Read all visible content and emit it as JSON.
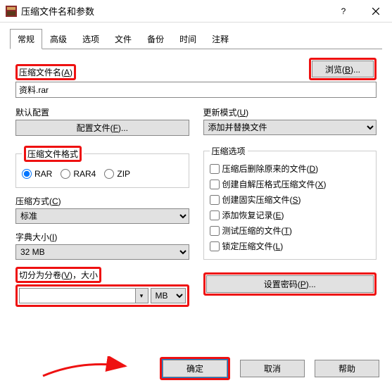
{
  "window": {
    "title": "压缩文件名和参数"
  },
  "tabs": [
    "常规",
    "高级",
    "选项",
    "文件",
    "备份",
    "时间",
    "注释"
  ],
  "archive_name": {
    "label_pre": "压缩文件名(",
    "label_key": "A",
    "label_post": ")",
    "value": "资料.rar"
  },
  "browse": {
    "pre": "浏览(",
    "key": "B",
    "post": ")..."
  },
  "profile": {
    "label": "默认配置",
    "btn_pre": "配置文件(",
    "btn_key": "F",
    "btn_post": ")..."
  },
  "update": {
    "label_pre": "更新模式(",
    "label_key": "U",
    "label_post": ")",
    "value": "添加并替换文件"
  },
  "format": {
    "legend": "压缩文件格式",
    "opts": [
      "RAR",
      "RAR4",
      "ZIP"
    ]
  },
  "method": {
    "label_pre": "压缩方式(",
    "label_key": "C",
    "label_post": ")",
    "value": "标准"
  },
  "dict": {
    "label_pre": "字典大小(",
    "label_key": "I",
    "label_post": ")",
    "value": "32 MB"
  },
  "split": {
    "label_pre": "切分为分卷(",
    "label_key": "V",
    "label_post": ")，大小",
    "unit": "MB"
  },
  "options": {
    "legend": "压缩选项",
    "items": [
      {
        "pre": "压缩后删除原来的文件(",
        "key": "D",
        "post": ")"
      },
      {
        "pre": "创建自解压格式压缩文件(",
        "key": "X",
        "post": ")"
      },
      {
        "pre": "创建固实压缩文件(",
        "key": "S",
        "post": ")"
      },
      {
        "pre": "添加恢复记录(",
        "key": "E",
        "post": ")"
      },
      {
        "pre": "测试压缩的文件(",
        "key": "T",
        "post": ")"
      },
      {
        "pre": "锁定压缩文件(",
        "key": "L",
        "post": ")"
      }
    ]
  },
  "password": {
    "pre": "设置密码(",
    "key": "P",
    "post": ")..."
  },
  "buttons": {
    "ok": "确定",
    "cancel": "取消",
    "help": "帮助"
  }
}
